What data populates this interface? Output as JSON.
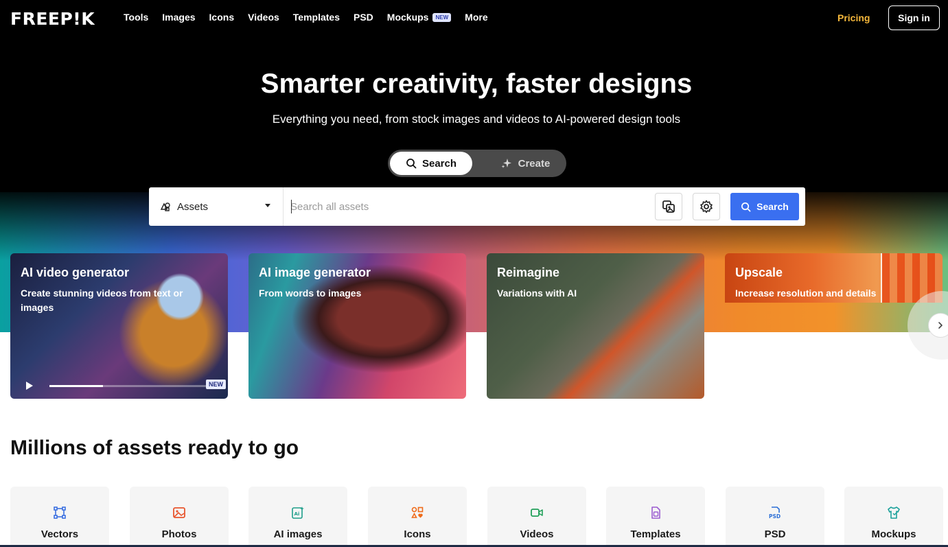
{
  "brand": {
    "logo": "FREEP!K"
  },
  "nav": {
    "items": [
      {
        "label": "Tools"
      },
      {
        "label": "Images"
      },
      {
        "label": "Icons"
      },
      {
        "label": "Videos"
      },
      {
        "label": "Templates"
      },
      {
        "label": "PSD"
      },
      {
        "label": "Mockups",
        "badge": "NEW"
      },
      {
        "label": "More"
      }
    ],
    "pricing": "Pricing",
    "signin": "Sign in"
  },
  "hero": {
    "title": "Smarter creativity, faster designs",
    "subtitle": "Everything you need, from stock images and videos to AI-powered design tools",
    "toggle": {
      "search": "Search",
      "create": "Create"
    }
  },
  "search": {
    "scope": "Assets",
    "placeholder": "Search all assets",
    "button": "Search"
  },
  "cards": [
    {
      "title": "AI video generator",
      "desc": "Create stunning videos from text or images",
      "badge": "NEW"
    },
    {
      "title": "AI image generator",
      "desc": "From words to images"
    },
    {
      "title": "Reimagine",
      "desc": "Variations with AI"
    },
    {
      "title": "Upscale",
      "desc": "Increase resolution and details"
    }
  ],
  "section": {
    "title": "Millions of assets ready to go"
  },
  "categories": [
    {
      "label": "Vectors",
      "icon": "vectors-icon",
      "color": "#3b6fe0"
    },
    {
      "label": "Photos",
      "icon": "photos-icon",
      "color": "#e8552e"
    },
    {
      "label": "AI images",
      "icon": "ai-images-icon",
      "color": "#1e9e8a"
    },
    {
      "label": "Icons",
      "icon": "icons-icon",
      "color": "#ef6b1a"
    },
    {
      "label": "Videos",
      "icon": "videos-icon",
      "color": "#22a05a"
    },
    {
      "label": "Templates",
      "icon": "templates-icon",
      "color": "#9b5bd0"
    },
    {
      "label": "PSD",
      "icon": "psd-icon",
      "color": "#2c6fd6"
    },
    {
      "label": "Mockups",
      "icon": "mockups-icon",
      "color": "#19a09a"
    }
  ],
  "colors": {
    "accent": "#3a6ff0",
    "pricing": "#f5b73b"
  }
}
